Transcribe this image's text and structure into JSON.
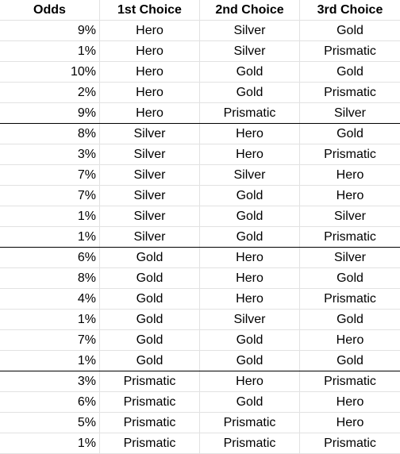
{
  "header": {
    "odds": "Odds",
    "first": "1st Choice",
    "second": "2nd Choice",
    "third": "3rd Choice"
  },
  "rows": [
    {
      "odds": "9%",
      "first": "Hero",
      "second": "Silver",
      "third": "Gold",
      "group_end": false
    },
    {
      "odds": "1%",
      "first": "Hero",
      "second": "Silver",
      "third": "Prismatic",
      "group_end": false
    },
    {
      "odds": "10%",
      "first": "Hero",
      "second": "Gold",
      "third": "Gold",
      "group_end": false
    },
    {
      "odds": "2%",
      "first": "Hero",
      "second": "Gold",
      "third": "Prismatic",
      "group_end": false
    },
    {
      "odds": "9%",
      "first": "Hero",
      "second": "Prismatic",
      "third": "Silver",
      "group_end": true
    },
    {
      "odds": "8%",
      "first": "Silver",
      "second": "Hero",
      "third": "Gold",
      "group_end": false
    },
    {
      "odds": "3%",
      "first": "Silver",
      "second": "Hero",
      "third": "Prismatic",
      "group_end": false
    },
    {
      "odds": "7%",
      "first": "Silver",
      "second": "Silver",
      "third": "Hero",
      "group_end": false
    },
    {
      "odds": "7%",
      "first": "Silver",
      "second": "Gold",
      "third": "Hero",
      "group_end": false
    },
    {
      "odds": "1%",
      "first": "Silver",
      "second": "Gold",
      "third": "Silver",
      "group_end": false
    },
    {
      "odds": "1%",
      "first": "Silver",
      "second": "Gold",
      "third": "Prismatic",
      "group_end": true
    },
    {
      "odds": "6%",
      "first": "Gold",
      "second": "Hero",
      "third": "Silver",
      "group_end": false
    },
    {
      "odds": "8%",
      "first": "Gold",
      "second": "Hero",
      "third": "Gold",
      "group_end": false
    },
    {
      "odds": "4%",
      "first": "Gold",
      "second": "Hero",
      "third": "Prismatic",
      "group_end": false
    },
    {
      "odds": "1%",
      "first": "Gold",
      "second": "Silver",
      "third": "Gold",
      "group_end": false
    },
    {
      "odds": "7%",
      "first": "Gold",
      "second": "Gold",
      "third": "Hero",
      "group_end": false
    },
    {
      "odds": "1%",
      "first": "Gold",
      "second": "Gold",
      "third": "Gold",
      "group_end": true
    },
    {
      "odds": "3%",
      "first": "Prismatic",
      "second": "Hero",
      "third": "Prismatic",
      "group_end": false
    },
    {
      "odds": "6%",
      "first": "Prismatic",
      "second": "Gold",
      "third": "Hero",
      "group_end": false
    },
    {
      "odds": "5%",
      "first": "Prismatic",
      "second": "Prismatic",
      "third": "Hero",
      "group_end": false
    },
    {
      "odds": "1%",
      "first": "Prismatic",
      "second": "Prismatic",
      "third": "Prismatic",
      "group_end": false
    }
  ]
}
